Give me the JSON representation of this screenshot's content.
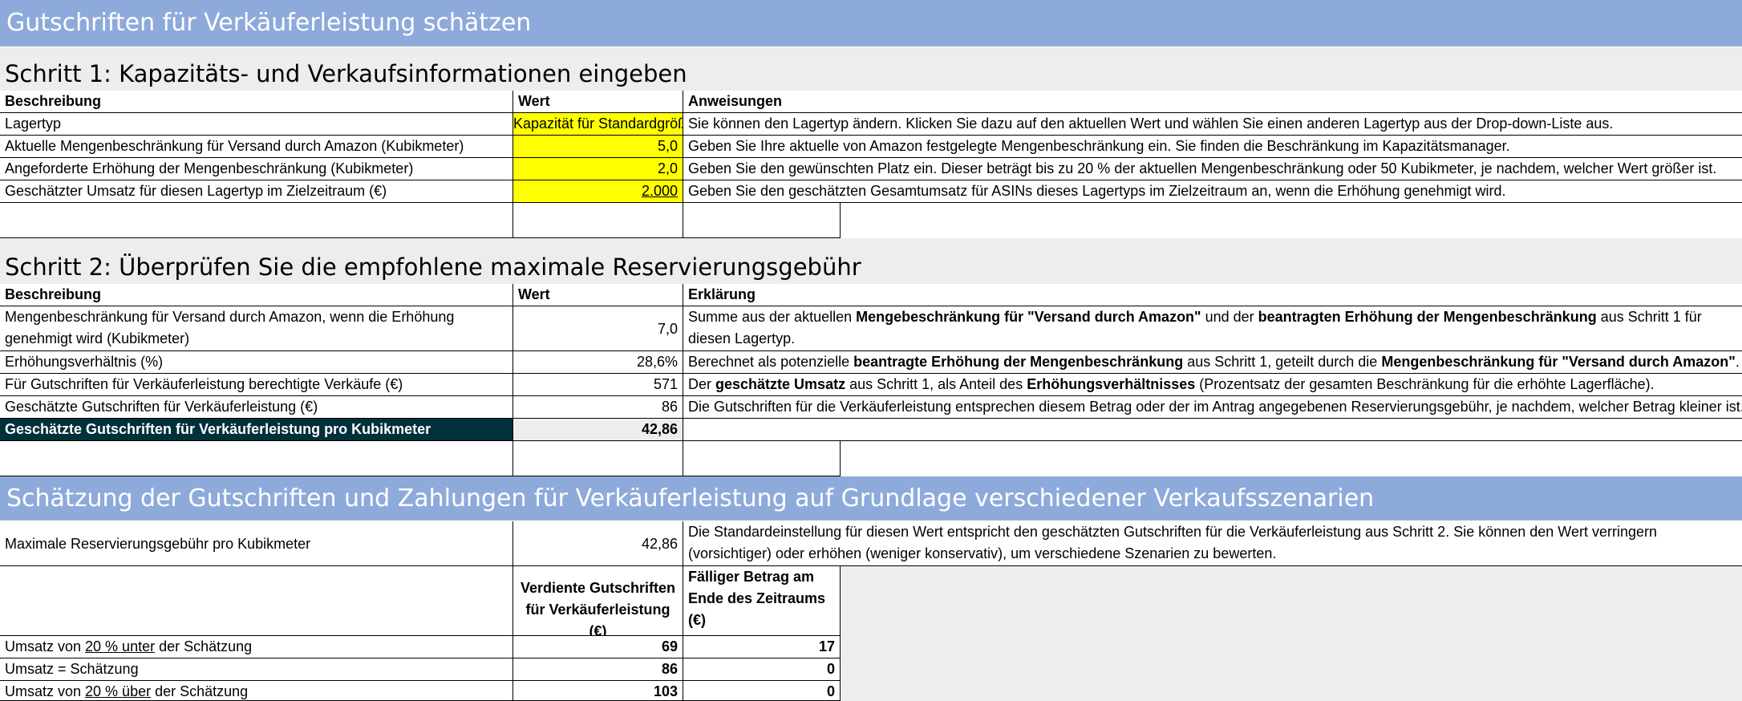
{
  "main_title": "Gutschriften für Verkäuferleistung schätzen",
  "step1": {
    "title": "Schritt 1: Kapazitäts- und Verkaufsinformationen eingeben",
    "headers": [
      "Beschreibung",
      "Wert",
      "Anweisungen"
    ],
    "rows": [
      {
        "desc": "Lagertyp",
        "value": "Kapazität für Standardgröße",
        "instruction": "Sie können den Lagertyp ändern. Klicken Sie dazu auf den aktuellen Wert und wählen Sie einen anderen Lagertyp aus der Drop-down-Liste aus."
      },
      {
        "desc": "Aktuelle Mengenbeschränkung für Versand durch Amazon (Kubikmeter)",
        "value": "5,0",
        "instruction": "Geben Sie Ihre aktuelle von Amazon festgelegte Mengenbeschränkung ein. Sie finden die Beschränkung im Kapazitätsmanager."
      },
      {
        "desc": "Angeforderte Erhöhung der Mengenbeschränkung (Kubikmeter)",
        "value": "2,0",
        "instruction": "Geben Sie den gewünschten Platz ein. Dieser beträgt bis zu 20 % der aktuellen Mengenbeschränkung oder 50 Kubikmeter, je nachdem, welcher Wert größer ist."
      },
      {
        "desc": "Geschätzter Umsatz für diesen Lagertyp im Zielzeitraum (€)",
        "value": "2.000",
        "instruction": "Geben Sie den geschätzten Gesamtumsatz für ASINs dieses Lagertyps im Zielzeitraum an, wenn die Erhöhung genehmigt wird."
      }
    ]
  },
  "step2": {
    "title": "Schritt 2: Überprüfen Sie die empfohlene maximale Reservierungsgebühr",
    "headers": [
      "Beschreibung",
      "Wert",
      "Erklärung"
    ],
    "rows": [
      {
        "desc": "Mengenbeschränkung für Versand durch Amazon, wenn die Erhöhung genehmigt wird (Kubikmeter)",
        "value": "7,0",
        "exp": [
          {
            "t": "Summe aus der aktuellen ",
            "b": false
          },
          {
            "t": "Mengebeschränkung für \"Versand durch Amazon\"",
            "b": true
          },
          {
            "t": " und der ",
            "b": false
          },
          {
            "t": "beantragten Erhöhung der Mengenbeschränkung",
            "b": true
          },
          {
            "t": " aus Schritt 1 für diesen Lagertyp.",
            "b": false
          }
        ]
      },
      {
        "desc": "Erhöhungsverhältnis (%)",
        "value": "28,6%",
        "exp": [
          {
            "t": "Berechnet als potenzielle ",
            "b": false
          },
          {
            "t": "beantragte Erhöhung der Mengenbeschränkung",
            "b": true
          },
          {
            "t": " aus Schritt 1, geteilt durch die ",
            "b": false
          },
          {
            "t": "Mengenbeschränkung für \"Versand durch Amazon\"",
            "b": true
          },
          {
            "t": ".",
            "b": false
          }
        ]
      },
      {
        "desc": "Für Gutschriften für Verkäuferleistung berechtigte Verkäufe (€)",
        "value": "571",
        "exp": [
          {
            "t": "Der ",
            "b": false
          },
          {
            "t": "geschätzte Umsatz",
            "b": true
          },
          {
            "t": " aus Schritt 1, als Anteil des ",
            "b": false
          },
          {
            "t": "Erhöhungsverhältnisses",
            "b": true
          },
          {
            "t": " (Prozentsatz der gesamten Beschränkung für die erhöhte Lagerfläche).",
            "b": false
          }
        ]
      },
      {
        "desc": "Geschätzte Gutschriften für Verkäuferleistung (€)",
        "value": "86",
        "exp": [
          {
            "t": "Die Gutschriften für die Verkäuferleistung entsprechen diesem Betrag oder der im Antrag angegebenen Reservierungsgebühr, je nachdem, welcher Betrag kleiner ist.",
            "b": false
          }
        ]
      }
    ],
    "summary": {
      "desc": "Geschätzte Gutschriften für Verkäuferleistung pro Kubikmeter",
      "value": "42,86"
    }
  },
  "section3": {
    "title": "Schätzung der Gutschriften und Zahlungen für Verkäuferleistung auf Grundlage verschiedener Verkaufsszenarien",
    "max_fee": {
      "desc": "Maximale Reservierungsgebühr pro Kubikmeter",
      "value": "42,86",
      "note": "Die Standardeinstellung für diesen Wert entspricht den geschätzten Gutschriften für die Verkäuferleistung aus Schritt 2. Sie können den Wert verringern (vorsichtiger) oder erhöhen (weniger konservativ), um verschiedene Szenarien zu bewerten."
    },
    "col_headers": [
      "Verdiente Gutschriften für Verkäuferleistung (€)",
      "Fälliger Betrag am Ende des Zeitraums (€)"
    ],
    "scenarios": [
      {
        "pre": "Umsatz von ",
        "u": "20 % unter",
        "post": " der Schätzung",
        "credits": "69",
        "due": "17"
      },
      {
        "pre": "Umsatz = Schätzung",
        "u": "",
        "post": "",
        "credits": "86",
        "due": "0"
      },
      {
        "pre": "Umsatz von ",
        "u": "20 % über",
        "post": " der Schätzung",
        "credits": "103",
        "due": "0"
      }
    ]
  }
}
